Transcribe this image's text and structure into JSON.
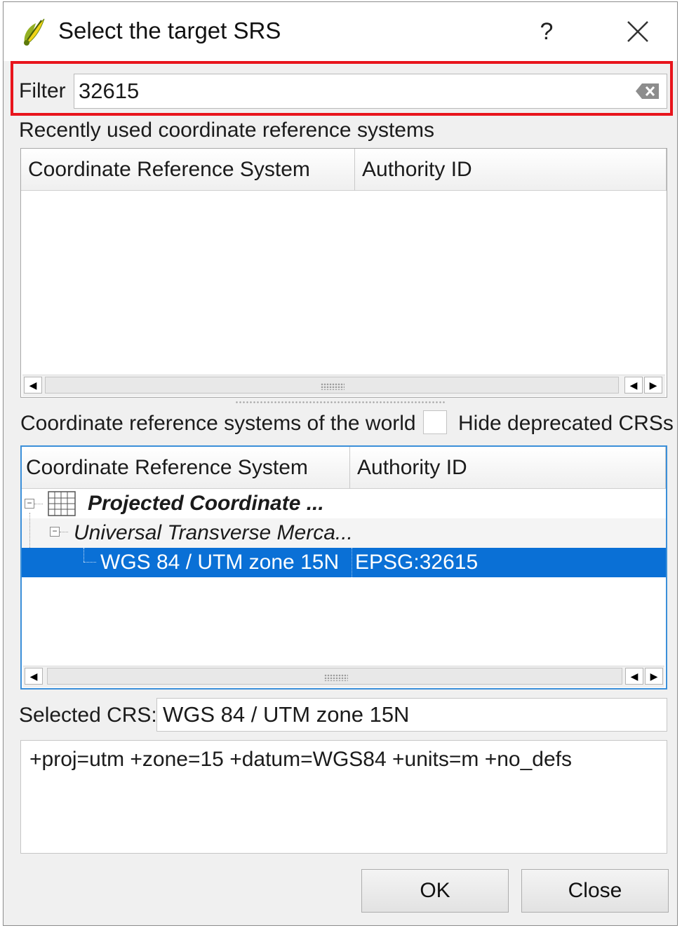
{
  "window": {
    "title": "Select the target SRS",
    "help_label": "?"
  },
  "filter": {
    "label": "Filter",
    "value": "32615"
  },
  "recent": {
    "caption": "Recently used coordinate reference systems",
    "columns": [
      "Coordinate Reference System",
      "Authority ID"
    ],
    "rows": []
  },
  "world": {
    "caption": "Coordinate reference systems of the world",
    "hide_deprecated_label": "Hide deprecated CRSs",
    "hide_deprecated_checked": false,
    "columns": [
      "Coordinate Reference System",
      "Authority ID"
    ],
    "tree": [
      {
        "label": "Projected Coordinate ...",
        "authority": "",
        "level": 0,
        "style": "bold-italic",
        "expanded": true
      },
      {
        "label": "Universal Transverse Merca...",
        "authority": "",
        "level": 1,
        "style": "italic",
        "expanded": true
      },
      {
        "label": "WGS 84 / UTM zone 15N",
        "authority": "EPSG:32615",
        "level": 2,
        "style": "normal",
        "selected": true
      }
    ]
  },
  "selected_crs": {
    "label": "Selected CRS:",
    "value": "WGS 84 / UTM zone 15N"
  },
  "proj_string": "+proj=utm +zone=15 +datum=WGS84 +units=m +no_defs",
  "buttons": {
    "ok": "OK",
    "close": "Close"
  },
  "colors": {
    "highlight_border": "#e8141c",
    "selection": "#0a70d6",
    "focus_border": "#3b8fd9"
  }
}
